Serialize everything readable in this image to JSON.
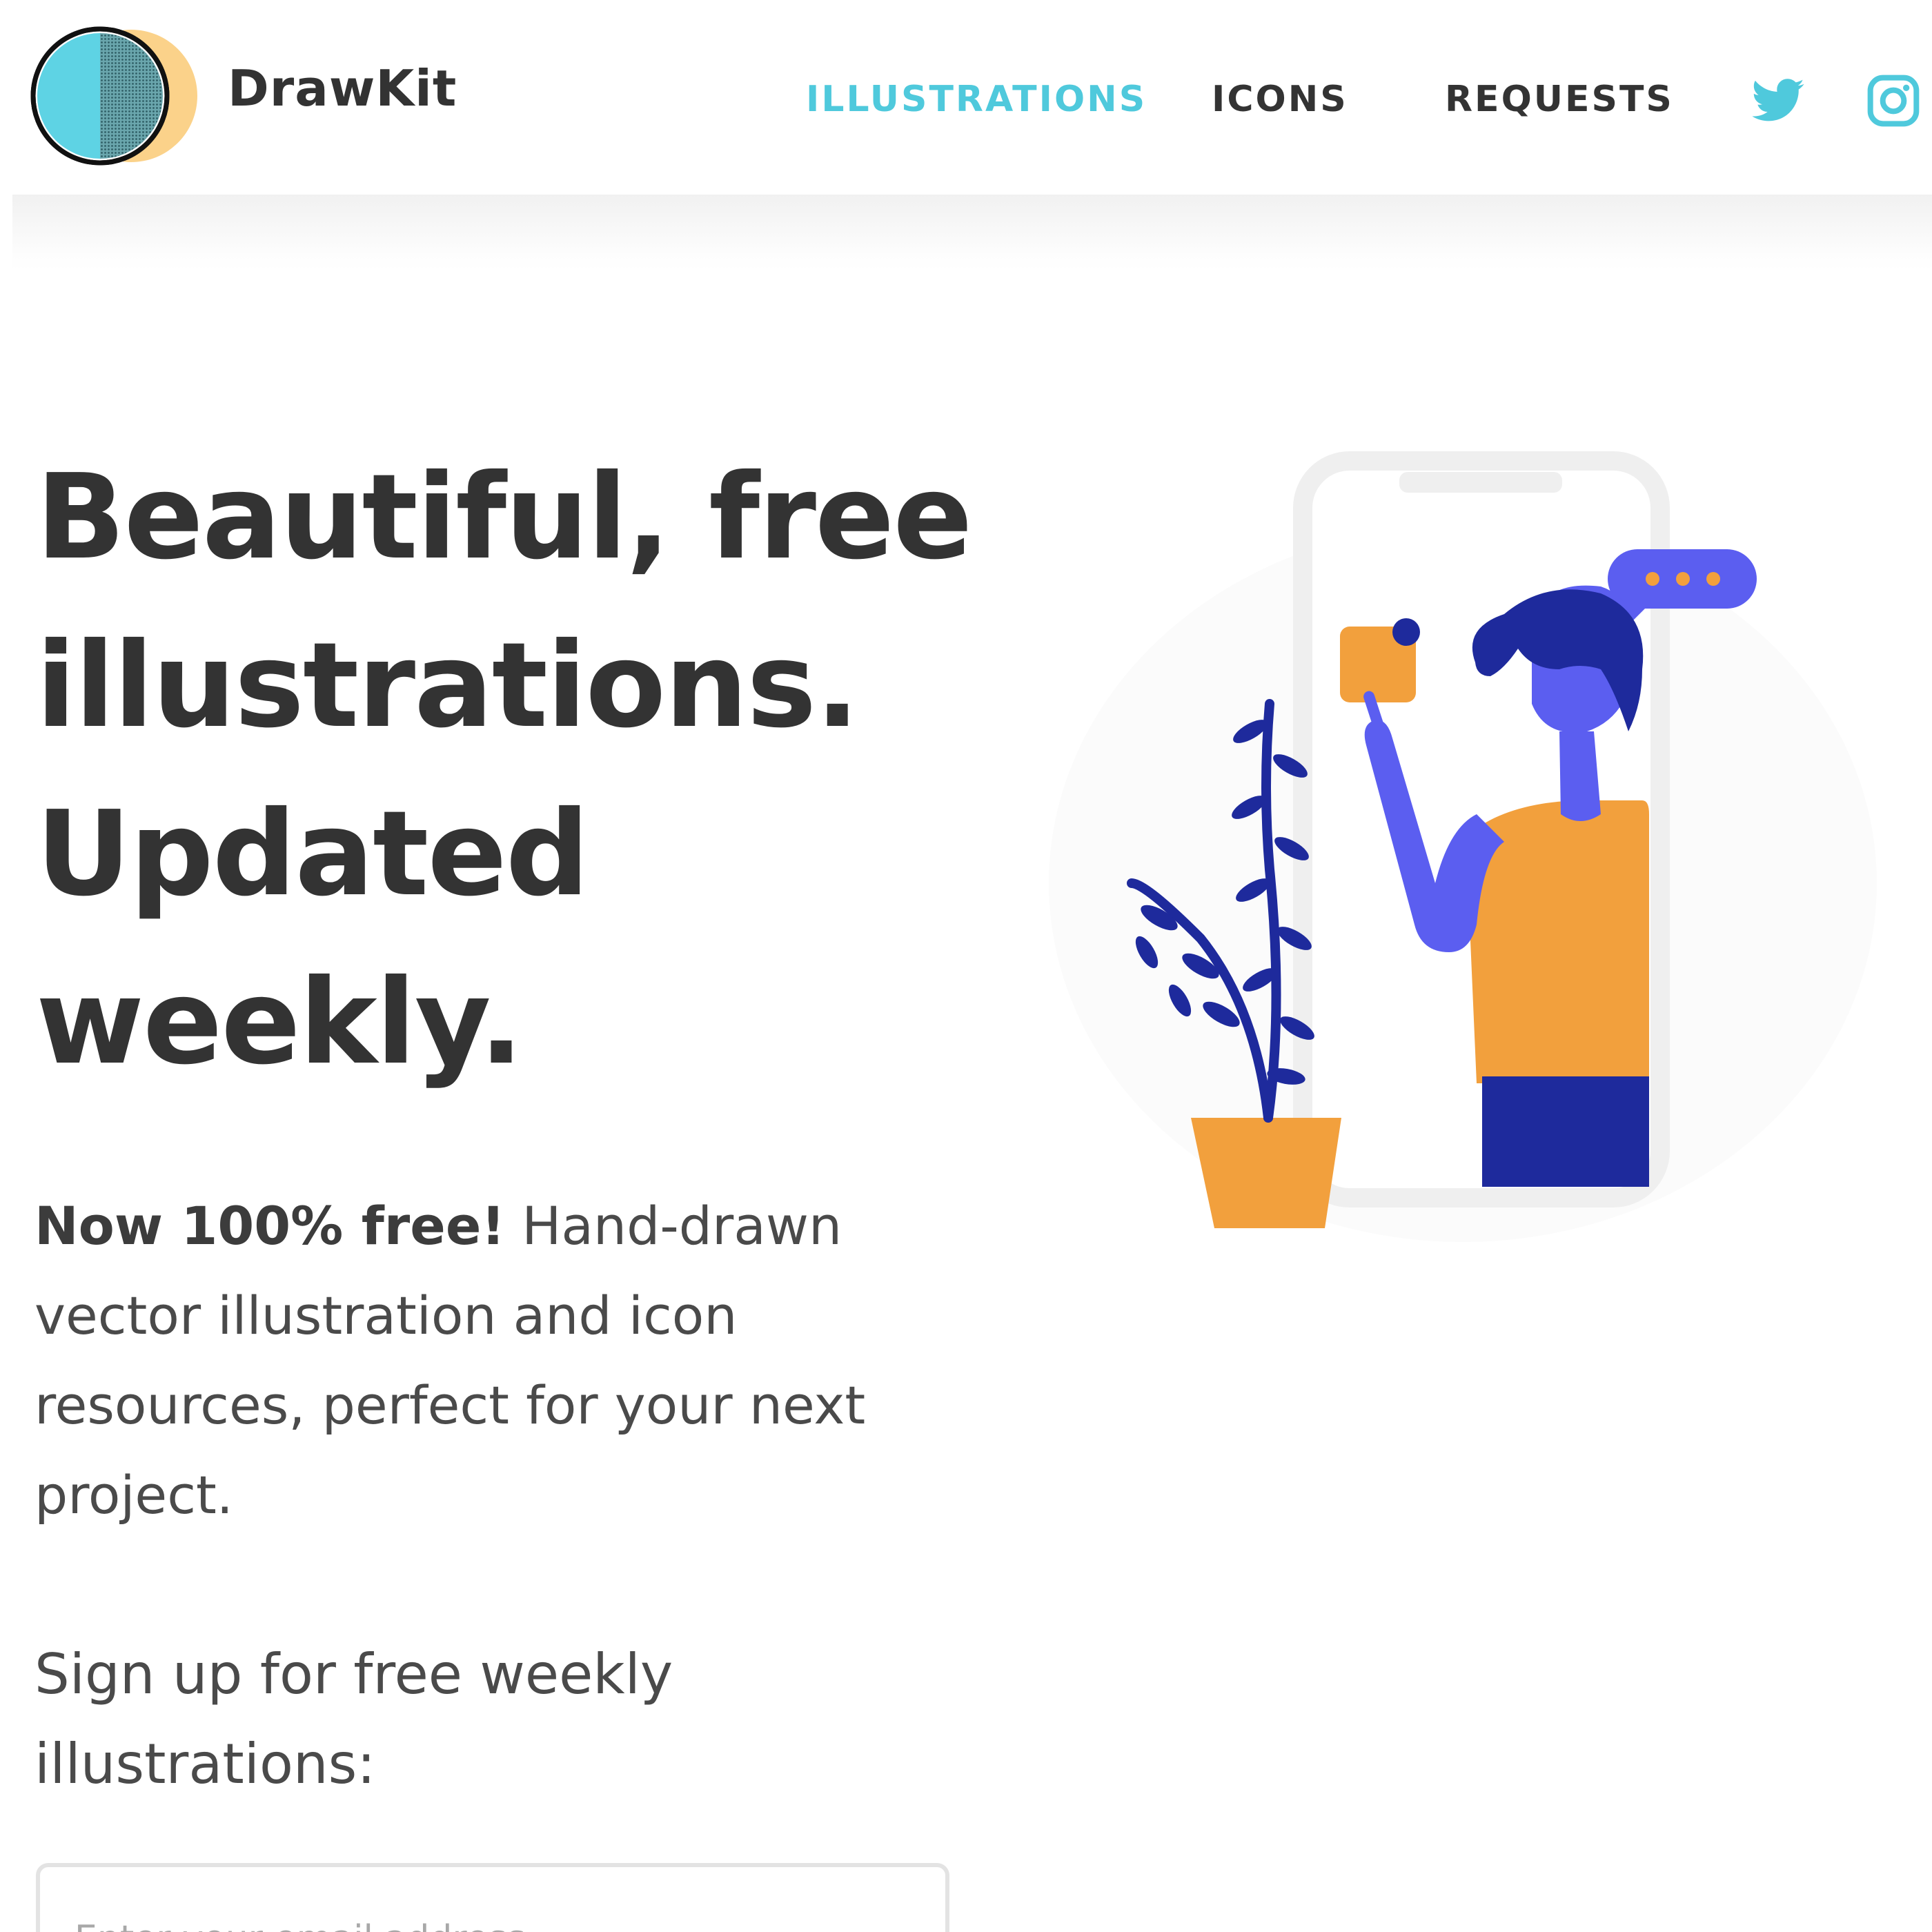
{
  "brand": {
    "name": "DrawKit",
    "logo_icon": "half-moon-logo-icon"
  },
  "nav": {
    "items": [
      {
        "label": "ILLUSTRATIONS",
        "active": true
      },
      {
        "label": "ICONS",
        "active": false
      },
      {
        "label": "REQUESTS",
        "active": false
      }
    ],
    "social": [
      {
        "icon": "twitter-icon"
      },
      {
        "icon": "instagram-icon"
      }
    ]
  },
  "hero": {
    "title_lines": [
      "Beautiful, free",
      "illustrations.",
      "Updated",
      "weekly."
    ],
    "intro_bold": "Now 100% free!",
    "intro_lines": [
      " Hand-drawn",
      "vector illustration and icon",
      "resources, perfect for your next",
      "project."
    ],
    "signup_lines": [
      "Sign up for free weekly",
      "illustrations:"
    ],
    "email_placeholder": "Enter your email address"
  },
  "illustration": {
    "icon": "person-phone-plant-illustration"
  },
  "colors": {
    "accent": "#4fc9dc",
    "text": "#333333",
    "orange": "#f2a03d",
    "purple": "#5b5ef0",
    "navy": "#1e2a9c",
    "logo_yellow": "#fbd28a"
  }
}
